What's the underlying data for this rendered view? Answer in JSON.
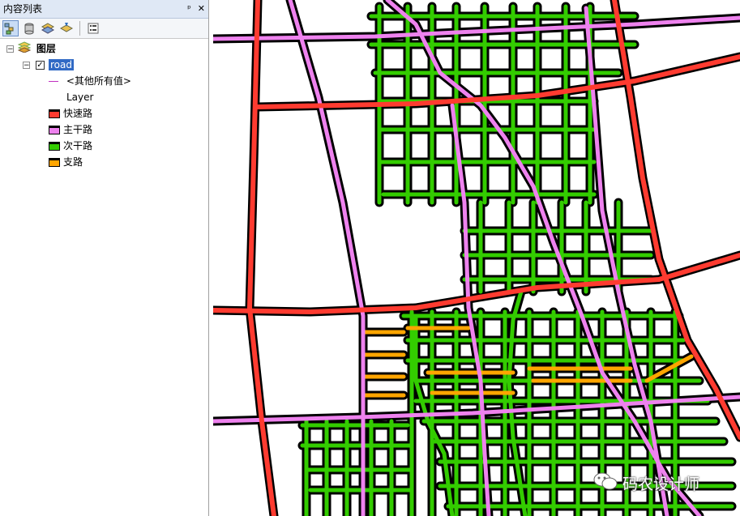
{
  "panel": {
    "title": "内容列表",
    "pin_label": "ᵖ",
    "close_label": "✕",
    "toolbar": [
      "list-by-drawing-order-icon",
      "list-by-source-icon",
      "list-by-visibility-icon",
      "list-by-selection-icon",
      "options-icon"
    ]
  },
  "tree": {
    "group_label": "图层",
    "layer_label": "road",
    "other_values_label": "<其他所有值>",
    "field_label": "Layer",
    "legend": [
      {
        "label": "快速路",
        "color": "#ff3b30"
      },
      {
        "label": "主干路",
        "color": "#ee82ee"
      },
      {
        "label": "次干路",
        "color": "#33cc00"
      },
      {
        "label": "支路",
        "color": "#ffa500"
      }
    ]
  },
  "map": {
    "colors": {
      "express": "#ff3b30",
      "arterial": "#ee82ee",
      "secondary": "#33cc00",
      "branch": "#ffa500",
      "outline": "#000000"
    }
  },
  "watermark": {
    "text": "码农设计师",
    "icon": "wechat-icon"
  }
}
